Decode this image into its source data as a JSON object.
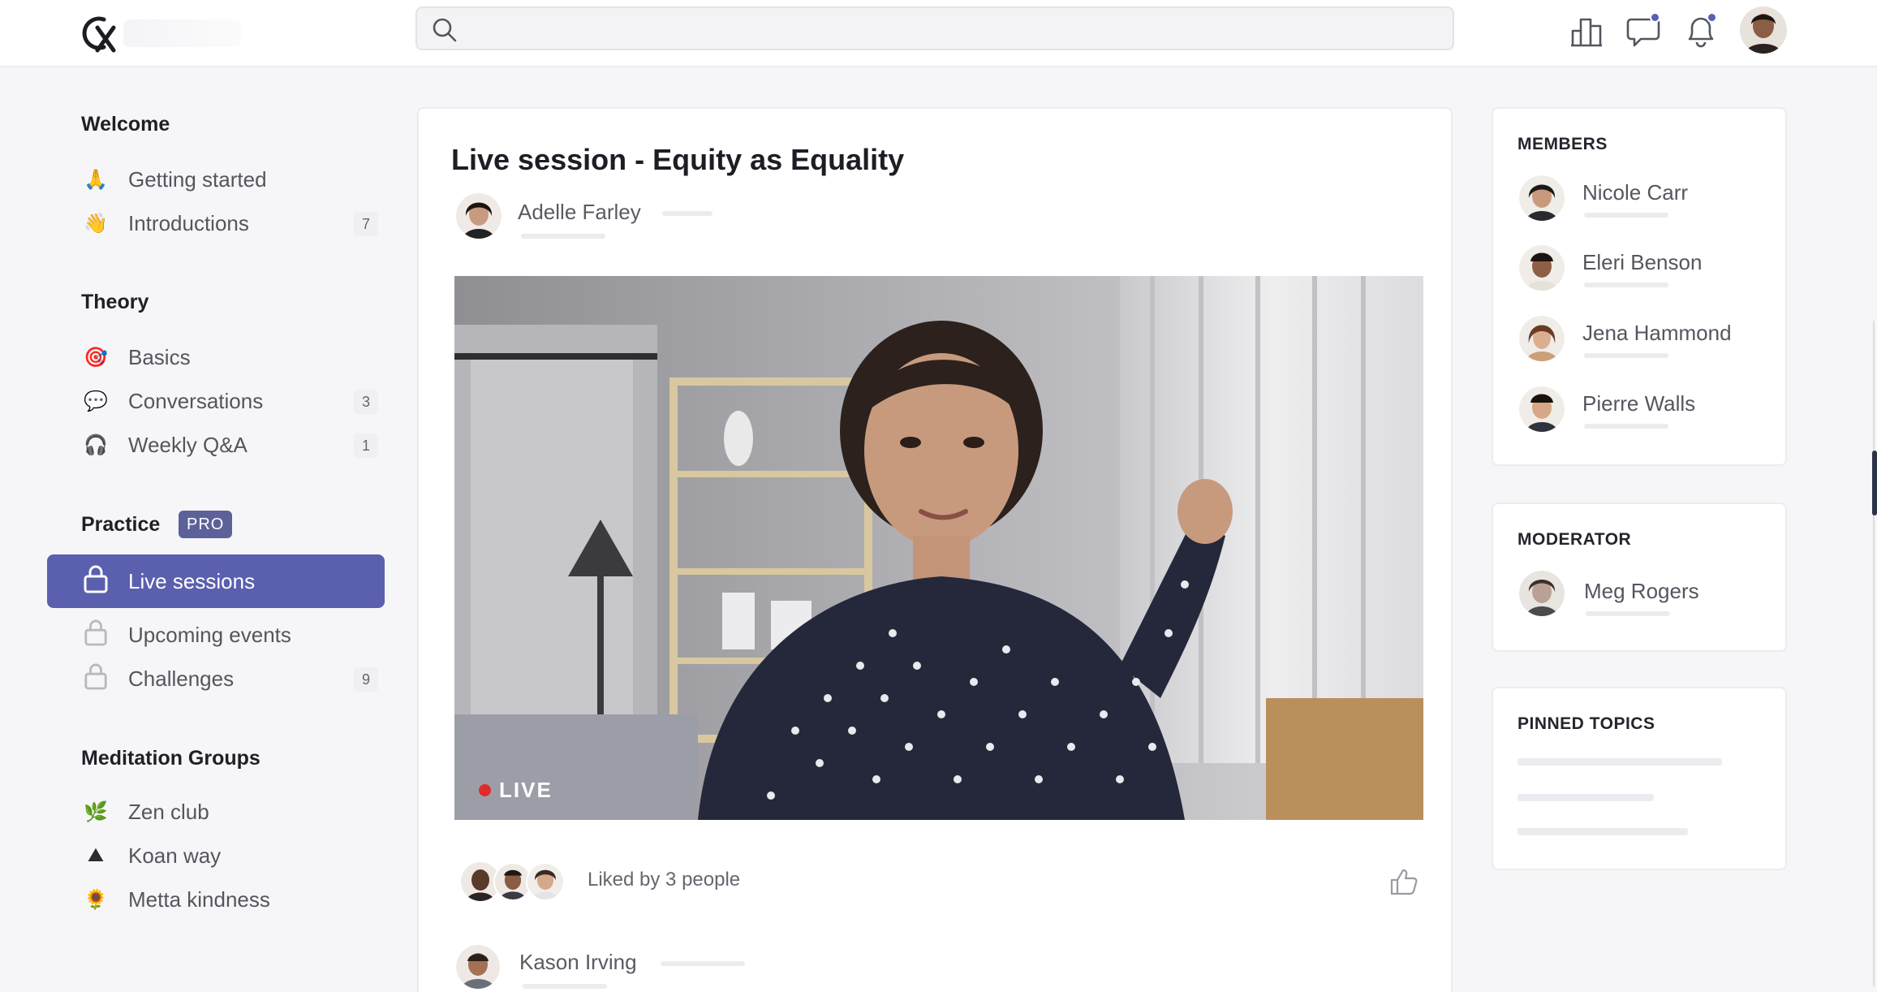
{
  "search": {
    "placeholder": ""
  },
  "topbar": {
    "icons": [
      "leaderboard-icon",
      "chat-icon",
      "bell-icon"
    ],
    "accent": "#5b5fb3"
  },
  "sidebar": {
    "sections": [
      {
        "title": "Welcome",
        "items": [
          {
            "icon": "🙏",
            "label": "Getting started",
            "count": ""
          },
          {
            "icon": "👋",
            "label": "Introductions",
            "count": "7"
          }
        ]
      },
      {
        "title": "Theory",
        "items": [
          {
            "icon": "🎯",
            "label": "Basics",
            "count": ""
          },
          {
            "icon": "💬",
            "label": "Conversations",
            "count": "3"
          },
          {
            "icon": "🎧",
            "label": "Weekly Q&A",
            "count": "1"
          }
        ]
      },
      {
        "title": "Practice",
        "badge": "PRO",
        "items": [
          {
            "icon": "lock",
            "label": "Live sessions",
            "count": "",
            "active": true
          },
          {
            "icon": "lock",
            "label": "Upcoming events",
            "count": ""
          },
          {
            "icon": "lock",
            "label": "Challenges",
            "count": "9"
          }
        ]
      },
      {
        "title": "Meditation Groups",
        "items": [
          {
            "icon": "🌿",
            "label": "Zen club",
            "count": ""
          },
          {
            "icon": "⛰",
            "label": "Koan way",
            "count": ""
          },
          {
            "icon": "🌻",
            "label": "Metta kindness",
            "count": ""
          }
        ]
      }
    ]
  },
  "post": {
    "title": "Live session - Equity as Equality",
    "author": "Adelle Farley",
    "live_label": "LIVE",
    "likes_text": "Liked by 3 people",
    "comment_author": "Kason Irving"
  },
  "members": {
    "title": "MEMBERS",
    "list": [
      "Nicole Carr",
      "Eleri Benson",
      "Jena Hammond",
      "Pierre Walls"
    ]
  },
  "moderator": {
    "title": "MODERATOR",
    "name": "Meg Rogers"
  },
  "pinned": {
    "title": "PINNED TOPICS"
  },
  "colors": {
    "active_nav": "#5a5fae",
    "live_dot": "#e12b2b",
    "badge": "#5d6199"
  }
}
